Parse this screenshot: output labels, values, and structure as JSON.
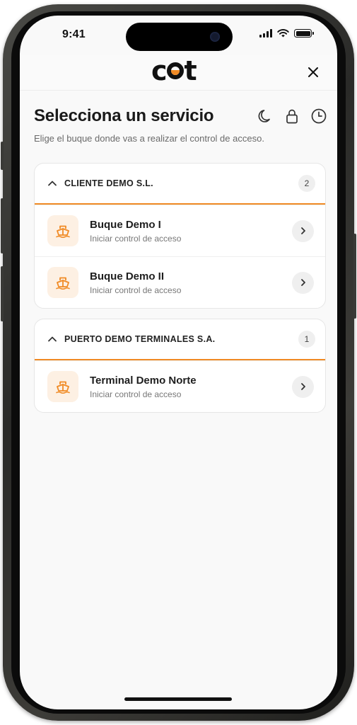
{
  "status_bar": {
    "time": "9:41"
  },
  "app": {
    "logo_text": "cot",
    "accent_color": "#f08a24"
  },
  "page": {
    "title": "Selecciona un servicio",
    "subtitle": "Elige el buque donde vas a realizar el control de acceso."
  },
  "header_icons": [
    "moon-icon",
    "lock-icon",
    "clock-icon"
  ],
  "groups": [
    {
      "name": "CLIENTE DEMO S.L.",
      "count": "2",
      "items": [
        {
          "title": "Buque Demo I",
          "subtitle": "Iniciar control de acceso"
        },
        {
          "title": "Buque Demo II",
          "subtitle": "Iniciar control de acceso"
        }
      ]
    },
    {
      "name": "PUERTO DEMO TERMINALES S.A.",
      "count": "1",
      "items": [
        {
          "title": "Terminal Demo Norte",
          "subtitle": "Iniciar control de acceso"
        }
      ]
    }
  ]
}
